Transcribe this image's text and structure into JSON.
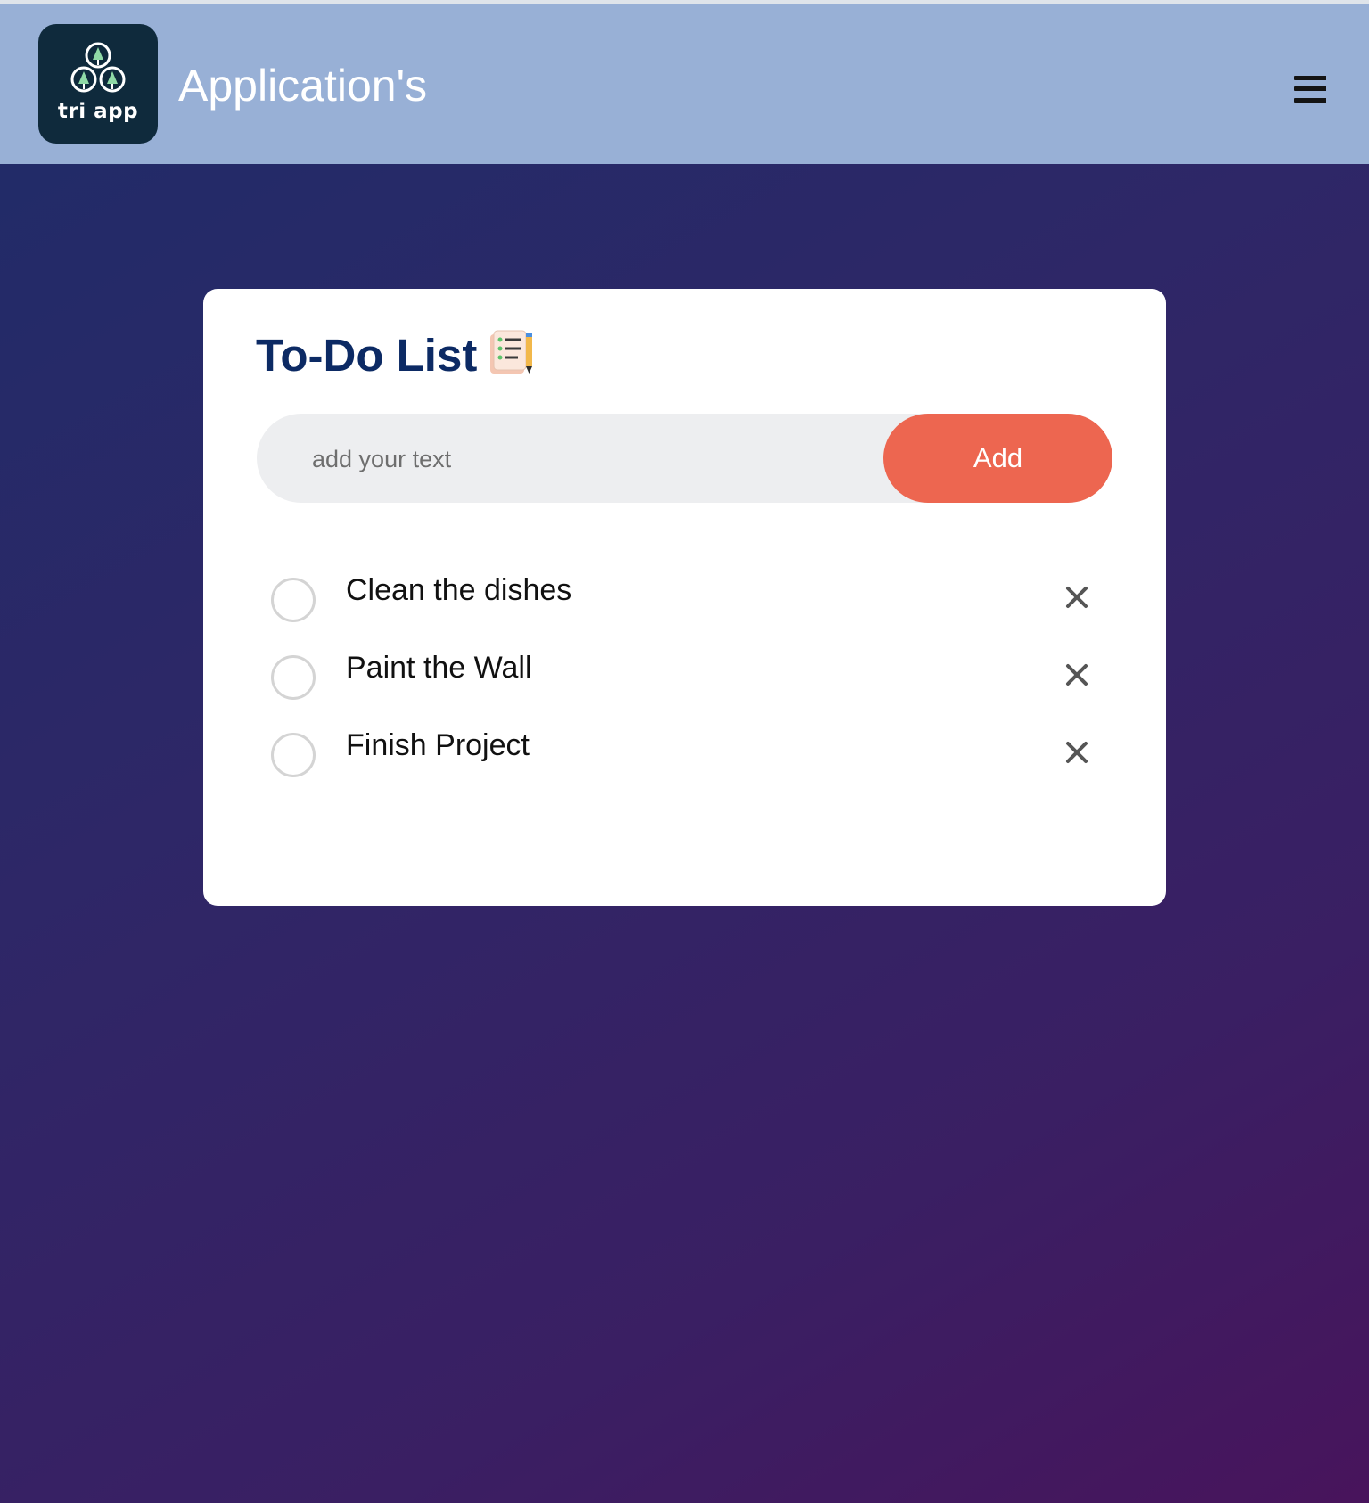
{
  "header": {
    "logo_text": "tri app",
    "title": "Application's",
    "menu_icon": "hamburger-menu-icon"
  },
  "todo": {
    "title": "To-Do List",
    "title_icon": "notepad-pencil-icon",
    "input": {
      "placeholder": "add your text",
      "value": ""
    },
    "add_label": "Add",
    "items": [
      {
        "text": "Clean the dishes",
        "checked": false
      },
      {
        "text": "Paint the Wall",
        "checked": false
      },
      {
        "text": "Finish Project",
        "checked": false
      }
    ]
  },
  "colors": {
    "header_bg": "#98b0d6",
    "logo_bg": "#0f2a3c",
    "accent": "#ed6650",
    "title_color": "#0c2a64",
    "background_gradient_start": "#1f2c68",
    "background_gradient_end": "#48145c"
  }
}
